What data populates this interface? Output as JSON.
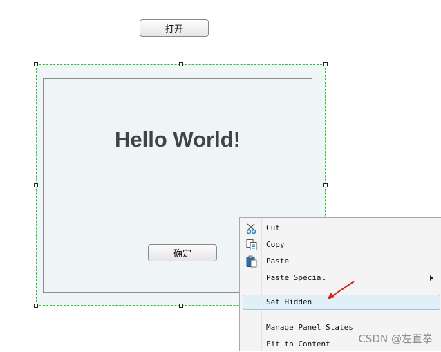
{
  "toolbar": {
    "open_label": "打开"
  },
  "canvas": {
    "title": "Hello World!",
    "ok_label": "确定"
  },
  "context_menu": {
    "items": [
      {
        "label": "Cut",
        "icon": "scissors-icon"
      },
      {
        "label": "Copy",
        "icon": "copy-icon"
      },
      {
        "label": "Paste",
        "icon": "clipboard-icon"
      },
      {
        "label": "Paste Special",
        "icon": "",
        "has_submenu": true
      },
      {
        "label": "Set Hidden",
        "icon": "",
        "highlighted": true
      },
      {
        "label": "Manage Panel States",
        "icon": ""
      },
      {
        "label": "Fit to Content",
        "icon": ""
      }
    ]
  },
  "watermark": "CSDN @左直拳",
  "colors": {
    "selection_border": "#2fc02f",
    "annotation_arrow": "#e0201c",
    "highlight": "#e1eff7"
  }
}
